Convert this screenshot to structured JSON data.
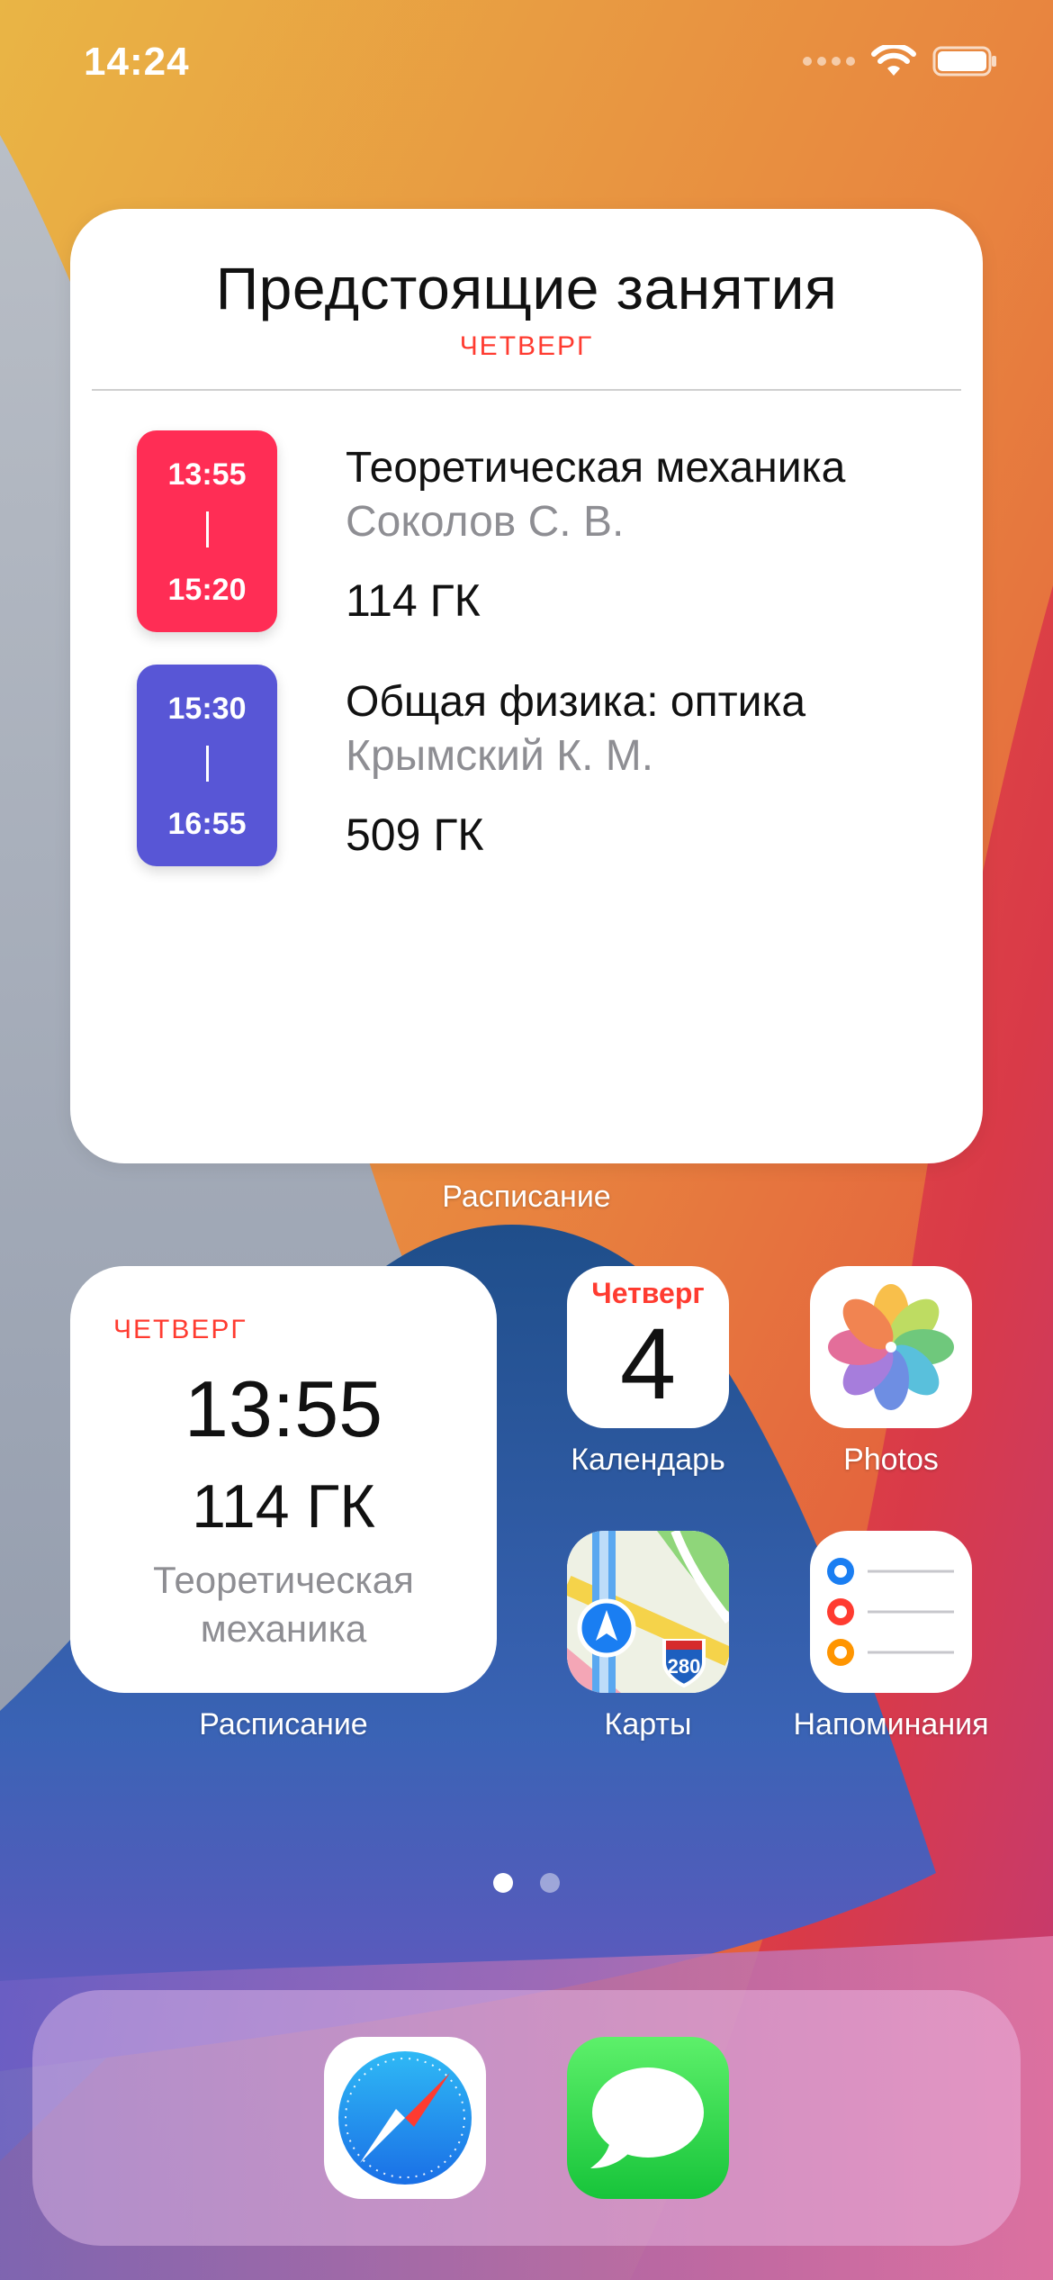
{
  "status_bar": {
    "time": "14:24"
  },
  "widget_large": {
    "title": "Предстоящие занятия",
    "day": "ЧЕТВЕРГ",
    "lessons": [
      {
        "start": "13:55",
        "separator": "|",
        "end": "15:20",
        "subject": "Теоретическая механика",
        "teacher": "Соколов С. В.",
        "room": "114 ГК",
        "color": "#ff2d55"
      },
      {
        "start": "15:30",
        "separator": "|",
        "end": "16:55",
        "subject": "Общая физика: оптика",
        "teacher": "Крымский К. М.",
        "room": "509 ГК",
        "color": "#5856d6"
      }
    ],
    "label": "Расписание"
  },
  "widget_small": {
    "day": "ЧЕТВЕРГ",
    "time": "13:55",
    "room": "114 ГК",
    "subject": "Теоретическая механика",
    "label": "Расписание"
  },
  "apps": {
    "calendar": {
      "label": "Календарь",
      "day": "Четверг",
      "date": "4"
    },
    "photos": {
      "label": "Photos"
    },
    "maps": {
      "label": "Карты",
      "shield_number": "280"
    },
    "reminders": {
      "label": "Напоминания"
    }
  },
  "page_indicator": {
    "pages": 2,
    "active": 1
  },
  "dock": {
    "apps": [
      "Safari",
      "Messages"
    ]
  },
  "colors": {
    "accent_red": "#ff3b30",
    "secondary_text": "#8e8e93"
  }
}
